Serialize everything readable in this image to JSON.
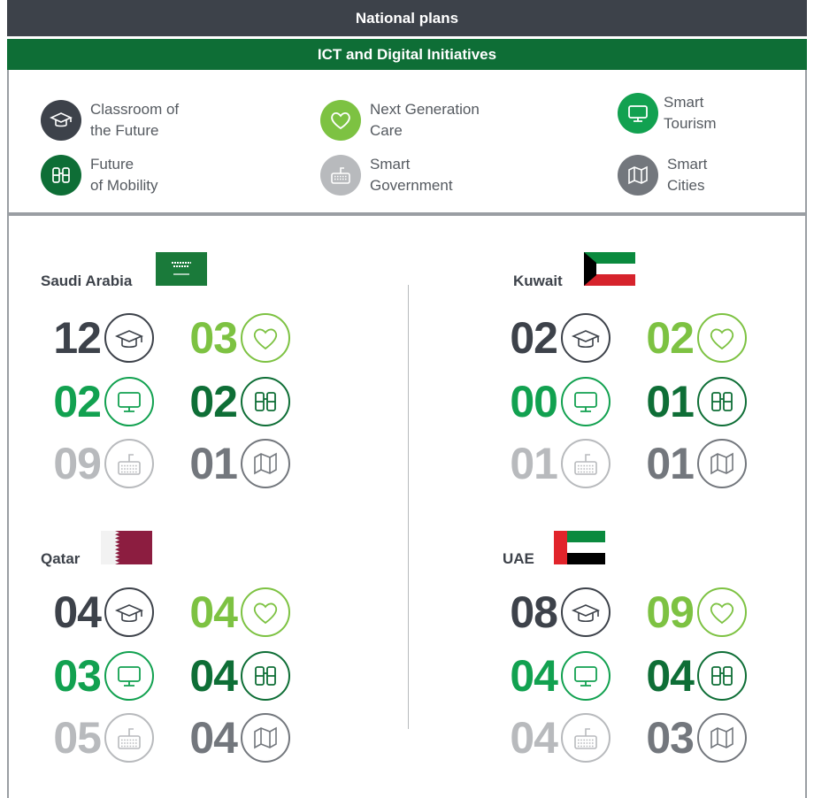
{
  "header": {
    "title": "National plans",
    "subtitle": "ICT and Digital Initiatives"
  },
  "legend": [
    {
      "line1": "Classroom of",
      "line2": "the Future",
      "icon": "graduation-cap-icon",
      "color": "#3d424a"
    },
    {
      "line1": "Next Generation",
      "line2": "Care",
      "icon": "heart-icon",
      "color": "#7dc242"
    },
    {
      "line1": "Smart",
      "line2": "Tourism",
      "icon": "monitor-icon",
      "color": "#12a150"
    },
    {
      "line1": "Future",
      "line2": "of Mobility",
      "icon": "binoculars-icon",
      "color": "#0e6e36"
    },
    {
      "line1": "Smart",
      "line2": "Government",
      "icon": "keyboard-icon",
      "color": "#b8babd"
    },
    {
      "line1": "Smart",
      "line2": "Cities",
      "icon": "map-icon",
      "color": "#73777d"
    }
  ],
  "countries": [
    {
      "name": "Saudi Arabia",
      "values": [
        "12",
        "03",
        "02",
        "02",
        "09",
        "01"
      ]
    },
    {
      "name": "Kuwait",
      "values": [
        "02",
        "02",
        "00",
        "01",
        "01",
        "01"
      ]
    },
    {
      "name": "Qatar",
      "values": [
        "04",
        "04",
        "03",
        "04",
        "05",
        "04"
      ]
    },
    {
      "name": "UAE",
      "values": [
        "08",
        "09",
        "04",
        "04",
        "04",
        "03"
      ]
    }
  ],
  "colors": {
    "header_dark": "#3d424a",
    "header_green": "#0e6e36",
    "dark": "#3d424a",
    "light_green": "#7dc242",
    "green": "#12a150",
    "dark_green": "#0e6e36",
    "light_grey": "#b8babd",
    "grey": "#73777d"
  }
}
